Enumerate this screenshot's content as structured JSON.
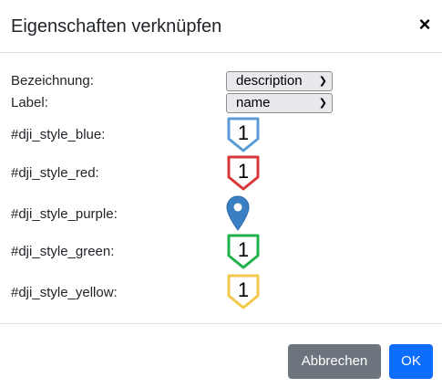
{
  "dialog": {
    "title": "Eigenschaften verknüpfen",
    "close_label": "×"
  },
  "fields": {
    "bezeichnung": {
      "label": "Bezeichnung:",
      "value": "description"
    },
    "label": {
      "label": "Label:",
      "value": "name"
    }
  },
  "styles": [
    {
      "name": "#dji_style_blue:",
      "marker": "1",
      "color": "#5b9bd5",
      "type": "shield"
    },
    {
      "name": "#dji_style_red:",
      "marker": "1",
      "color": "#d9383a",
      "type": "shield"
    },
    {
      "name": "#dji_style_purple:",
      "marker": "",
      "color": "#3a7fc4",
      "type": "pin"
    },
    {
      "name": "#dji_style_green:",
      "marker": "1",
      "color": "#22b24c",
      "type": "shield"
    },
    {
      "name": "#dji_style_yellow:",
      "marker": "1",
      "color": "#f2c94c",
      "type": "shield"
    }
  ],
  "buttons": {
    "cancel": "Abbrechen",
    "ok": "OK"
  },
  "icons": {
    "dropdown": "chevron-down-icon",
    "close": "close-icon"
  }
}
